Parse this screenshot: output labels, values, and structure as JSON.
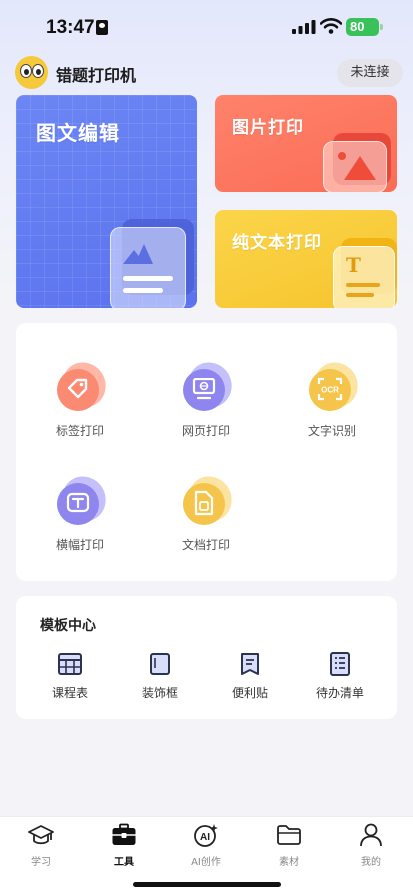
{
  "status_bar": {
    "time": "13:47",
    "battery": "80"
  },
  "header": {
    "title": "错题打印机",
    "connect_label": "未连接"
  },
  "feature_cards": {
    "edit": {
      "label": "图文编辑",
      "color": "#6579f1",
      "icon": "document-image-icon"
    },
    "image_print": {
      "label": "图片打印",
      "color": "#fb7560",
      "icon": "picture-icon"
    },
    "text_print": {
      "label": "纯文本打印",
      "color": "#f8cb3a",
      "icon": "text-document-icon"
    }
  },
  "tools": [
    {
      "label": "标签打印",
      "icon": "tag-icon",
      "color": "#fb8a73"
    },
    {
      "label": "网页打印",
      "icon": "web-monitor-icon",
      "color": "#8e86ee"
    },
    {
      "label": "文字识别",
      "icon": "ocr-icon",
      "color": "#f5c54b"
    },
    {
      "label": "横幅打印",
      "icon": "banner-text-icon",
      "color": "#8e86ee"
    },
    {
      "label": "文档打印",
      "icon": "document-icon",
      "color": "#f5c54b"
    }
  ],
  "templates": {
    "title": "模板中心",
    "items": [
      {
        "label": "课程表",
        "icon": "schedule-icon"
      },
      {
        "label": "装饰框",
        "icon": "frame-icon"
      },
      {
        "label": "便利贴",
        "icon": "sticky-note-icon"
      },
      {
        "label": "待办清单",
        "icon": "checklist-icon"
      }
    ]
  },
  "tab_bar": {
    "active": "工具",
    "tabs": [
      {
        "label": "学习",
        "icon": "graduation-cap-icon"
      },
      {
        "label": "工具",
        "icon": "toolbox-icon"
      },
      {
        "label": "AI创作",
        "icon": "ai-sparkle-icon"
      },
      {
        "label": "素材",
        "icon": "folder-icon"
      },
      {
        "label": "我的",
        "icon": "person-icon"
      }
    ]
  }
}
